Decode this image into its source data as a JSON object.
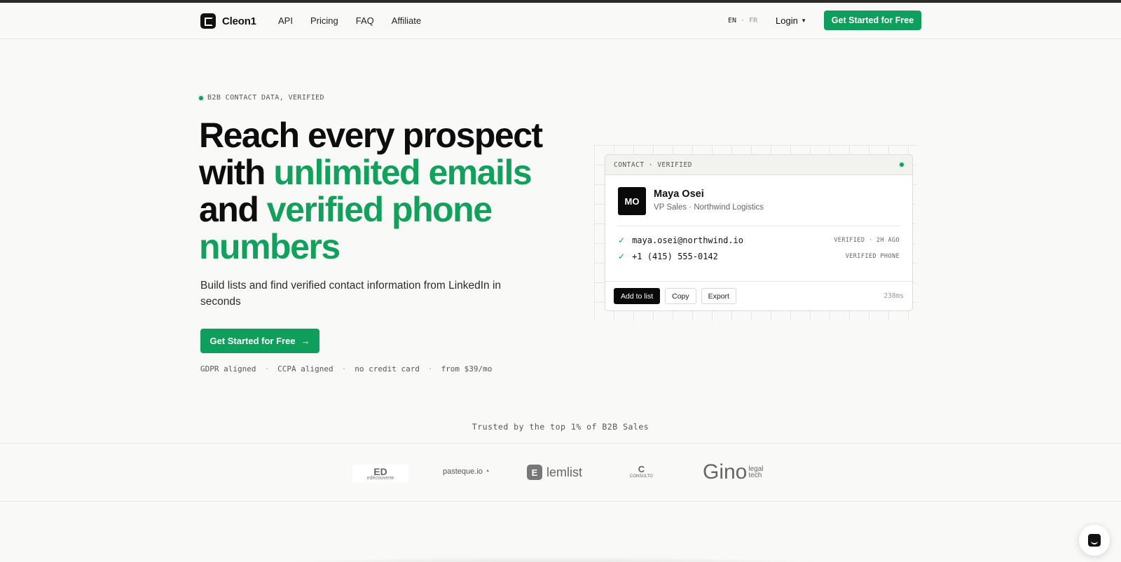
{
  "brand": {
    "name": "Cleon1"
  },
  "nav": {
    "links": [
      "API",
      "Pricing",
      "FAQ",
      "Affiliate"
    ],
    "lang": {
      "en": "EN",
      "sep": "·",
      "fr": "FR"
    },
    "login": "Login",
    "cta": "Get Started for Free"
  },
  "hero": {
    "eyebrow": "B2B CONTACT DATA, VERIFIED",
    "headline": {
      "p1": "Reach every prospect with ",
      "g1": "unlimited emails",
      "p2": " and ",
      "g2": "verified phone numbers"
    },
    "subtitle": "Build lists and find verified contact information from LinkedIn in seconds",
    "cta": "Get Started for Free",
    "cta_arrow": "→",
    "badges": [
      "GDPR aligned",
      "CCPA aligned",
      "no credit card",
      "from $39/mo"
    ],
    "badge_sep": "·"
  },
  "card": {
    "header": "CONTACT · VERIFIED",
    "initials": "MO",
    "name": "Maya Osei",
    "role": "VP Sales · Northwind Logistics",
    "email": "maya.osei@northwind.io",
    "email_status": "VERIFIED · 2H AGO",
    "phone": "+1 (415) 555-0142",
    "phone_status": "VERIFIED PHONE",
    "actions": {
      "add": "Add to list",
      "copy": "Copy",
      "export": "Export"
    },
    "latency": "238ms",
    "check": "✓"
  },
  "trusted": {
    "title": "Trusted by the top 1% of B2B Sales",
    "logos": {
      "ed_mark": "ED",
      "ed_text": "edécouverte",
      "pasteque": "pasteque.io",
      "lemlist_mark": "E",
      "lemlist": "lemlist",
      "consulto_mark": "C",
      "consulto": "CONSULTO",
      "gino": "Gino",
      "gino_small1": "legal",
      "gino_small2": "tech"
    }
  },
  "colors": {
    "accent": "#0e9f5c",
    "dark": "#0a0a0a",
    "background": "#f9f9f7"
  }
}
